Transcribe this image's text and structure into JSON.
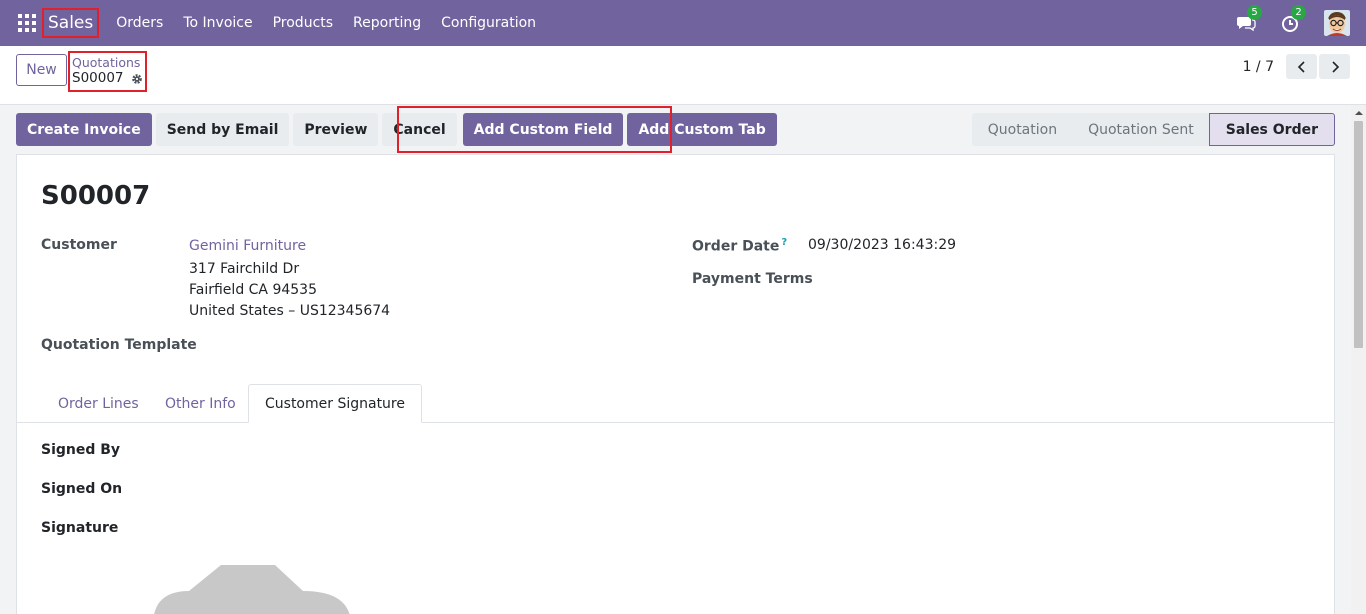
{
  "navbar": {
    "brand": "Sales",
    "menu": [
      "Orders",
      "To Invoice",
      "Products",
      "Reporting",
      "Configuration"
    ],
    "messages_count": "5",
    "activities_count": "2",
    "bg_color": "#71639e"
  },
  "control_panel": {
    "new_label": "New",
    "breadcrumb_parent": "Quotations",
    "breadcrumb_current": "S00007",
    "pager_value": "1 / 7"
  },
  "actions": {
    "create_invoice": "Create Invoice",
    "send_by_email": "Send by Email",
    "preview": "Preview",
    "cancel": "Cancel",
    "add_custom_field": "Add Custom Field",
    "add_custom_tab": "Add Custom Tab"
  },
  "statusbar": {
    "stages": [
      "Quotation",
      "Quotation Sent",
      "Sales Order"
    ],
    "active": "Sales Order"
  },
  "form": {
    "title": "S00007",
    "customer_label": "Customer",
    "customer_name": "Gemini Furniture",
    "address_line1": "317 Fairchild Dr",
    "address_line2": "Fairfield CA 94535",
    "address_line3": "United States – US12345674",
    "quotation_template_label": "Quotation Template",
    "order_date_label": "Order Date",
    "order_date_tooltip": "?",
    "order_date_value": "09/30/2023 16:43:29",
    "payment_terms_label": "Payment Terms"
  },
  "tabs": {
    "order_lines": "Order Lines",
    "other_info": "Other Info",
    "customer_signature": "Customer Signature",
    "active": "Customer Signature"
  },
  "signature_tab": {
    "signed_by_label": "Signed By",
    "signed_on_label": "Signed On",
    "signature_label": "Signature"
  }
}
